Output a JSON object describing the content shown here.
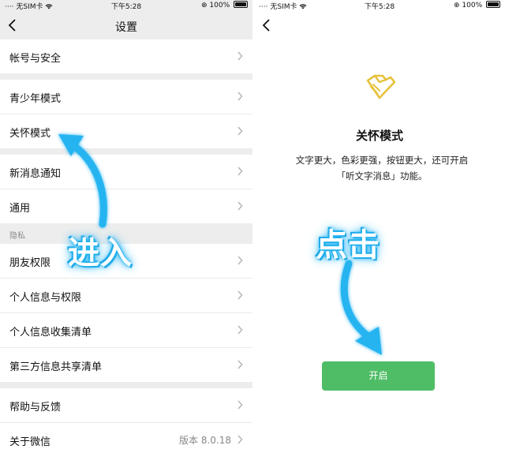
{
  "left_screen": {
    "status": {
      "carrier": "无SIM卡",
      "time": "下午5:28",
      "battery": "100%"
    },
    "nav": {
      "title": "设置"
    },
    "rows": {
      "account": "帐号与安全",
      "youth": "青少年模式",
      "care": "关怀模式",
      "notify": "新消息通知",
      "general": "通用",
      "privacy_header": "隐私",
      "friend_perm": "朋友权限",
      "personal_info": "个人信息与权限",
      "info_collect": "个人信息收集清单",
      "third_party": "第三方信息共享清单",
      "help": "帮助与反馈",
      "about": "关于微信",
      "about_version": "版本 8.0.18"
    },
    "annotation": "进入"
  },
  "right_screen": {
    "status": {
      "carrier": "无SIM卡",
      "time": "下午5:28",
      "battery": "100%"
    },
    "care_title": "关怀模式",
    "care_desc_line1": "文字更大，色彩更强，按钮更大，还可开启",
    "care_desc_line2": "「听文字消息」功能。",
    "enable_button": "开启",
    "annotation": "点击"
  },
  "colors": {
    "accent_green": "#4fbd66",
    "icon_gold": "#e7c23c",
    "arrow_blue": "#27b4f1",
    "page_gray": "#ededed"
  },
  "icons": [
    "back-chevron-icon",
    "chevron-right-icon",
    "care-mode-icon",
    "wifi-icon",
    "battery-icon",
    "orientation-lock-icon"
  ]
}
